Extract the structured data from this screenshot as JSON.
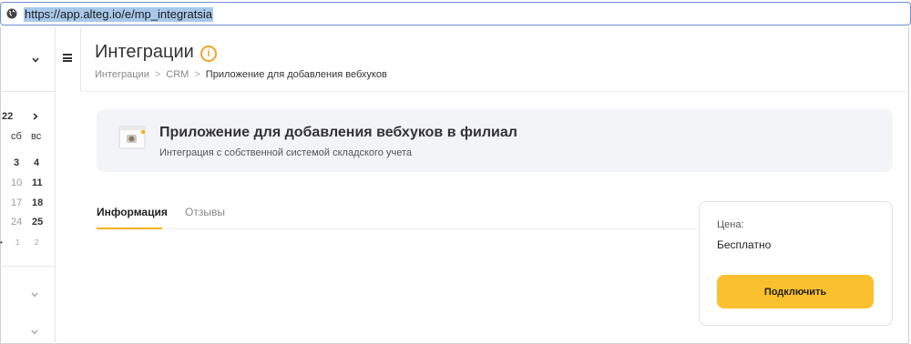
{
  "browser": {
    "url": "https://app.alteg.io/e/mp_integratsia",
    "globe_icon": "globe-icon"
  },
  "calendar": {
    "year_fragment": "22",
    "weekdays": [
      "сб",
      "вс"
    ],
    "rows": [
      [
        "3",
        "4"
      ],
      [
        "10",
        "11"
      ],
      [
        "17",
        "18"
      ],
      [
        "24",
        "25"
      ],
      [
        "1",
        "2"
      ]
    ],
    "row_partial_left": [
      "",
      "",
      "",
      "",
      "•"
    ]
  },
  "header": {
    "title": "Интеграции",
    "info_icon": "i",
    "breadcrumb": [
      "Интеграции",
      "CRM",
      "Приложение для добавления вебхуков"
    ],
    "breadcrumb_separator": ">"
  },
  "card": {
    "title": "Приложение для добавления вебхуков в филиал",
    "subtitle": "Интеграция с собственной системой складского учета"
  },
  "tabs": [
    {
      "label": "Информация",
      "active": true
    },
    {
      "label": "Отзывы",
      "active": false
    }
  ],
  "pricing": {
    "label": "Цена:",
    "value": "Бесплатно",
    "button_label": "Подключить"
  },
  "colors": {
    "accent": "#fbc02d",
    "info": "#f0a524",
    "url_highlight": "#a8c8ea"
  }
}
